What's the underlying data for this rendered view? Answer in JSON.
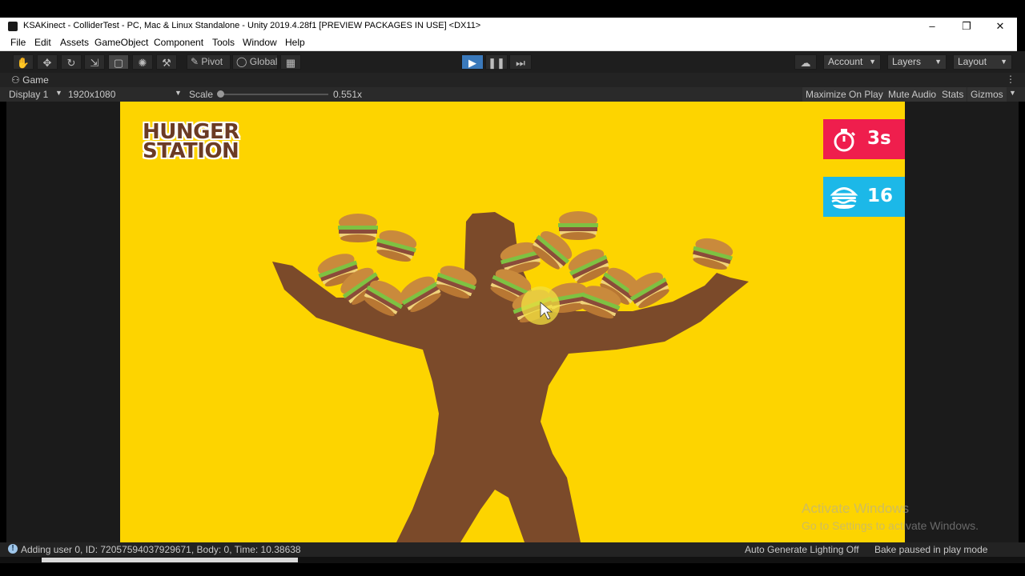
{
  "window": {
    "title": "KSAKinect - ColliderTest - PC, Mac & Linux Standalone - Unity 2019.4.28f1 [PREVIEW PACKAGES IN USE] <DX11>",
    "controls": {
      "minimize": "–",
      "restore": "❐",
      "close": "✕"
    }
  },
  "menu": [
    "File",
    "Edit",
    "Assets",
    "GameObject",
    "Component",
    "Tools",
    "Window",
    "Help"
  ],
  "toolbar": {
    "tools": [
      "hand-tool-icon",
      "move-tool-icon",
      "rotate-tool-icon",
      "scale-tool-icon",
      "rect-tool-icon",
      "transform-tool-icon",
      "custom-tool-icon"
    ],
    "pivot_label": "Pivot",
    "global_label": "Global",
    "account_label": "Account",
    "layers_label": "Layers",
    "layout_label": "Layout"
  },
  "game_tab": {
    "title": "Game",
    "display": "Display 1",
    "resolution": "1920x1080",
    "scale_label": "Scale",
    "scale_value": "0.551x",
    "scale_level": 0.0,
    "maximize_on_play": "Maximize On Play",
    "mute_audio": "Mute Audio",
    "stats": "Stats",
    "gizmos": "Gizmos"
  },
  "game": {
    "logo_line1": "HUNGER",
    "logo_line2": "STATION",
    "timer_value": "3s",
    "score_value": "16",
    "colors": {
      "background": "#fdd400",
      "silhouette": "#7b4a2a",
      "timer_bg": "#ef1e4d",
      "score_bg": "#1cb8e8",
      "logo": "#6b3b24"
    }
  },
  "watermark": {
    "line1": "Activate Windows",
    "line2": "Go to Settings to activate Windows."
  },
  "status": {
    "message": "Adding user 0, ID: 72057594037929671, Body: 0, Time: 10.38638",
    "lighting": "Auto Generate Lighting Off",
    "bake": "Bake paused in play mode"
  }
}
